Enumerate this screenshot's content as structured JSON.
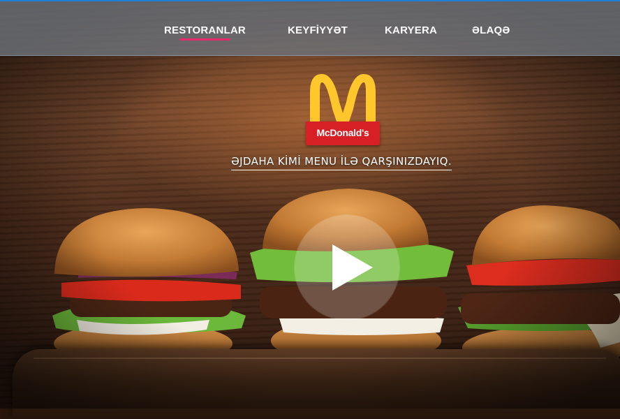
{
  "nav": {
    "items": [
      {
        "label": "RESTORANLAR",
        "active": true
      },
      {
        "label": "KEYFİYYƏT",
        "active": false
      },
      {
        "label": "KARYERA",
        "active": false
      },
      {
        "label": "ƏLAQƏ",
        "active": false
      }
    ]
  },
  "logo": {
    "wordmark": "McDonald's"
  },
  "hero": {
    "tagline": "ƏJDAHA KİMİ MENU İLƏ QARŞINIZDAYIQ.",
    "media_icon": "play-icon"
  },
  "colors": {
    "nav_accent": "#e8296b",
    "nav_top_border": "#1f7fd6",
    "logo_red": "#d71f26",
    "logo_gold": "#ffc72c"
  }
}
